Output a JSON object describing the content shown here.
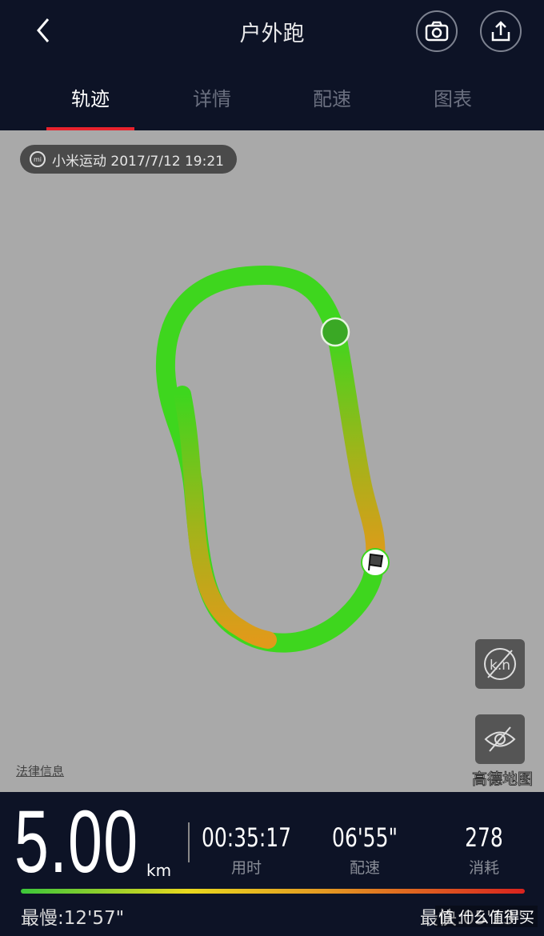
{
  "header": {
    "title": "户外跑",
    "back_icon": "chevron-left-icon",
    "camera_icon": "camera-icon",
    "share_icon": "share-icon"
  },
  "tabs": [
    {
      "label": "轨迹",
      "active": true
    },
    {
      "label": "详情"
    },
    {
      "label": "配速"
    },
    {
      "label": "图表"
    }
  ],
  "map": {
    "stamp": "小米运动  2017/7/12 19:21",
    "stamp_logo": "mi",
    "legal": "法律信息",
    "provider": "高德地图",
    "km_marker_toggle_icon": "km-marker-off-icon",
    "hide_icon": "eye-off-icon",
    "start_color": "#3aa825",
    "track_colors": [
      "#3ed61e",
      "#a3b31a",
      "#e09a1a"
    ]
  },
  "summary": {
    "distance": "5.00",
    "distance_unit": "km",
    "duration": "00:35:17",
    "duration_label": "用时",
    "pace": "06'55\"",
    "pace_label": "配速",
    "calories": "278",
    "calories_label": "消耗",
    "slowest": "最慢:12'57\"",
    "fastest": "最快:05'13\"",
    "watermark": "值 什么值得买"
  }
}
